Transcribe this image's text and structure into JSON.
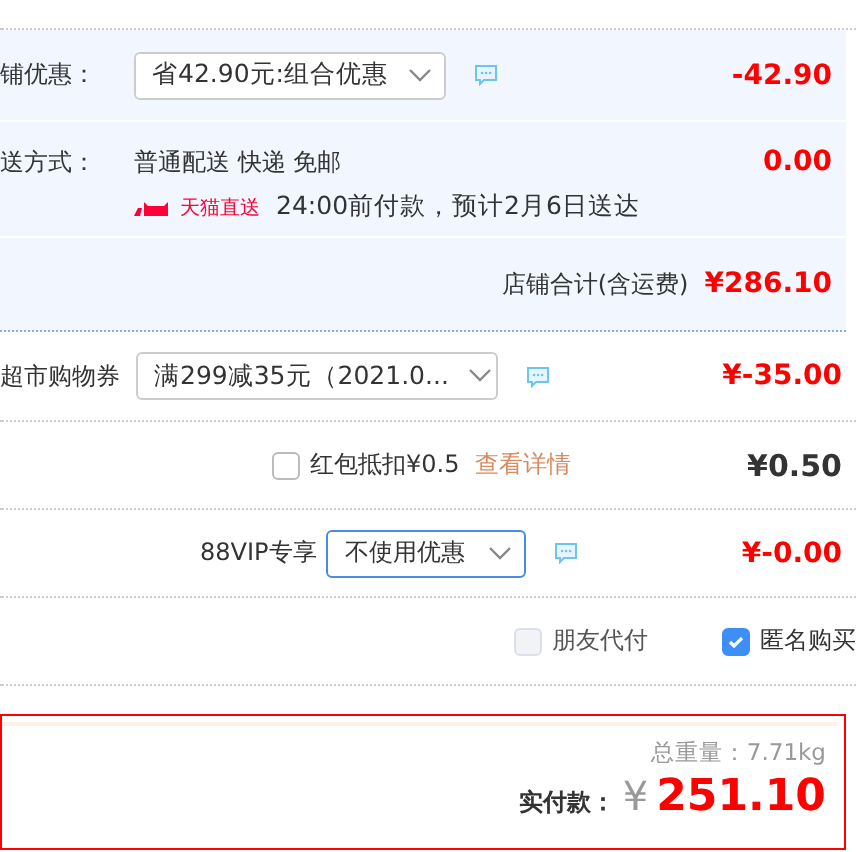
{
  "shop_discount": {
    "label": "铺优惠：",
    "select": "省42.90元:组合优惠",
    "amount": "-42.90"
  },
  "delivery": {
    "label": "送方式：",
    "method": "普通配送 快递 免邮",
    "badge": "天猫直送",
    "note": "24:00前付款，预计2月6日送达",
    "amount": "0.00"
  },
  "shop_total": {
    "label": "店铺合计(含运费)",
    "amount": "¥286.10"
  },
  "coupon": {
    "label": "超市购物券",
    "select": "满299减35元（2021.0...",
    "amount": "¥-35.00"
  },
  "red_packet": {
    "label": "红包抵扣¥0.5",
    "checked": false,
    "link": "查看详情",
    "amount": "¥0.50"
  },
  "vip": {
    "label": "88VIP专享",
    "select": "不使用优惠",
    "focused": true,
    "amount": "¥-0.00"
  },
  "options": [
    {
      "label": "朋友代付",
      "checked": false,
      "disabled": true
    },
    {
      "label": "匿名购买",
      "checked": true,
      "disabled": false
    }
  ],
  "summary": {
    "weight_label": "总重量：",
    "weight": "7.71kg",
    "pay_label": "实付款：",
    "currency": "¥",
    "total": "251.10"
  }
}
